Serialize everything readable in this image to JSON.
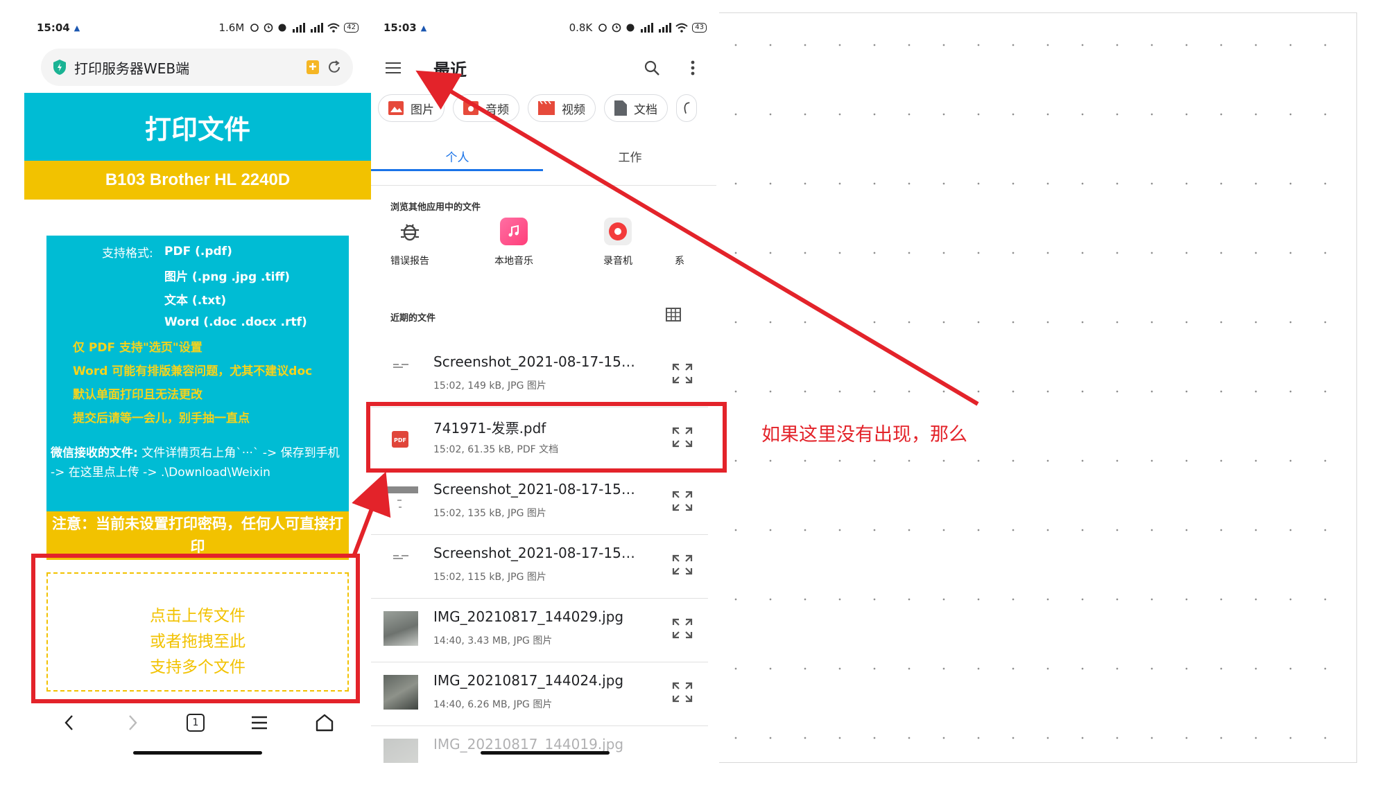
{
  "left_phone": {
    "status": {
      "time": "15:04",
      "net": "1.6M",
      "battery": "42"
    },
    "url_title": "打印服务器WEB端",
    "header_title": "打印文件",
    "printer_name": "B103 Brother HL 2240D",
    "formats": {
      "label": "支持格式:",
      "items": [
        "PDF (.pdf)",
        "图片 (.png .jpg .tiff)",
        "文本 (.txt)",
        "Word (.doc .docx .rtf)"
      ]
    },
    "warnings": [
      "仅 PDF 支持\"选页\"设置",
      "Word 可能有排版兼容问题，尤其不建议doc",
      "默认单面打印且无法更改",
      "提交后请等一会儿，别手抽一直点"
    ],
    "wechat": {
      "label": "微信接收的文件:",
      "text": " 文件详情页右上角`···` -> 保存到手机 -> 在这里点上传 -> .\\Download\\Weixin"
    },
    "notice": "注意：当前未设置打印密码，任何人可直接打印",
    "upload": {
      "line1": "点击上传文件",
      "line2": "或者拖拽至此",
      "line3": "支持多个文件"
    },
    "tab_count": "1"
  },
  "right_phone": {
    "status": {
      "time": "15:03",
      "net": "0.8K",
      "battery": "43"
    },
    "title": "最近",
    "chips": [
      "图片",
      "音频",
      "视频",
      "文档"
    ],
    "tabs": [
      "个人",
      "工作"
    ],
    "browse_label": "浏览其他应用中的文件",
    "apps": [
      "错误报告",
      "本地音乐",
      "录音机",
      "系"
    ],
    "recent_label": "近期的文件",
    "files": [
      {
        "name": "Screenshot_2021-08-17-15…",
        "meta": "15:02, 149 kB, JPG 图片"
      },
      {
        "name": "741971-发票.pdf",
        "meta": "15:02, 61.35 kB, PDF 文档",
        "badge": "PDF"
      },
      {
        "name": "Screenshot_2021-08-17-15…",
        "meta": "15:02, 135 kB, JPG 图片"
      },
      {
        "name": "Screenshot_2021-08-17-15…",
        "meta": "15:02, 115 kB, JPG 图片"
      },
      {
        "name": "IMG_20210817_144029.jpg",
        "meta": "14:40, 3.43 MB, JPG 图片"
      },
      {
        "name": "IMG_20210817_144024.jpg",
        "meta": "14:40, 6.26 MB, JPG 图片"
      },
      {
        "name": "IMG_20210817_144019.jpg",
        "meta": ""
      }
    ]
  },
  "annotation": {
    "text": "如果这里没有出现，那么",
    "color": "#e3232a"
  }
}
